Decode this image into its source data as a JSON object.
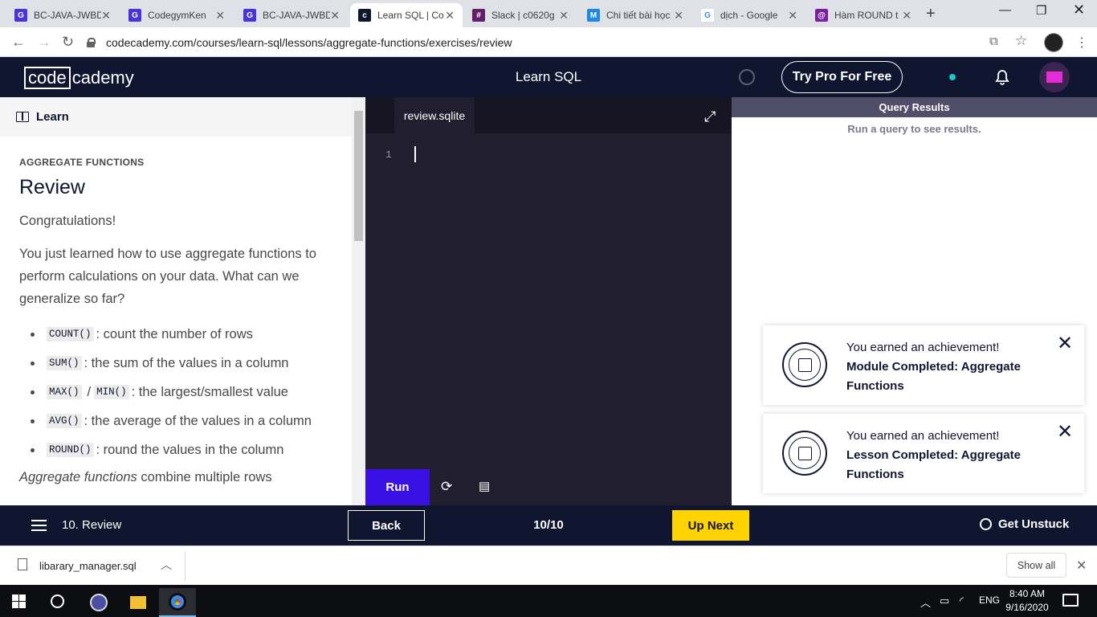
{
  "browser": {
    "tabs": [
      {
        "title": "BC-JAVA-JWBD",
        "icon_color": "#4a33d9",
        "icon_letter": "G"
      },
      {
        "title": "CodegymKen",
        "icon_color": "#4a33d9",
        "icon_letter": "G"
      },
      {
        "title": "BC-JAVA-JWBD",
        "icon_color": "#4a33d9",
        "icon_letter": "G"
      },
      {
        "title": "Learn SQL | Co",
        "icon_color": "#10162f",
        "icon_letter": "c"
      },
      {
        "title": "Slack | c0620g",
        "icon_color": "#611f69",
        "icon_letter": "#"
      },
      {
        "title": "Chi tiết bài học",
        "icon_color": "#1e88e5",
        "icon_letter": "M"
      },
      {
        "title": "dịch - Google",
        "icon_color": "#ffffff",
        "icon_letter": "G"
      },
      {
        "title": "Hàm ROUND t",
        "icon_color": "#7b1fa2",
        "icon_letter": "@"
      }
    ],
    "active_tab": 3,
    "url": "codecademy.com/courses/learn-sql/lessons/aggregate-functions/exercises/review"
  },
  "header": {
    "logo_boxed": "code",
    "logo_rest": "cademy",
    "course_title": "Learn SQL",
    "pro_button": "Try Pro For Free"
  },
  "lesson": {
    "learn_label": "Learn",
    "kicker": "AGGREGATE FUNCTIONS",
    "title": "Review",
    "intro": "Congratulations!",
    "para": "You just learned how to use aggregate functions to perform calculations on your data. What can we generalize so far?",
    "items": [
      {
        "code": "COUNT()",
        "text": ": count the number of rows"
      },
      {
        "code": "SUM()",
        "text": ": the sum of the values in a column"
      },
      {
        "code": "MAX()",
        "code2": "MIN()",
        "text": ": the largest/smallest value"
      },
      {
        "code": "AVG()",
        "text": ": the average of the values in a column"
      },
      {
        "code": "ROUND()",
        "text": ": round the values in the column"
      }
    ],
    "cut_em": "Aggregate functions",
    "cut_rest": " combine multiple rows"
  },
  "editor": {
    "filename": "review.sqlite",
    "line_number": "1",
    "run_label": "Run"
  },
  "results": {
    "header": "Query Results",
    "empty": "Run a query to see results."
  },
  "achievements": [
    {
      "line1": "You earned an achievement!",
      "line2": "Module Completed: Aggregate Functions"
    },
    {
      "line1": "You earned an achievement!",
      "line2": "Lesson Completed: Aggregate Functions"
    }
  ],
  "bottom_nav": {
    "lesson_name": "10. Review",
    "back": "Back",
    "progress": "10/10",
    "next": "Up Next",
    "unstuck": "Get Unstuck"
  },
  "downloads": {
    "file": "libarary_manager.sql",
    "show_all": "Show all"
  },
  "taskbar": {
    "lang": "ENG",
    "time": "8:40 AM",
    "date": "9/16/2020"
  }
}
